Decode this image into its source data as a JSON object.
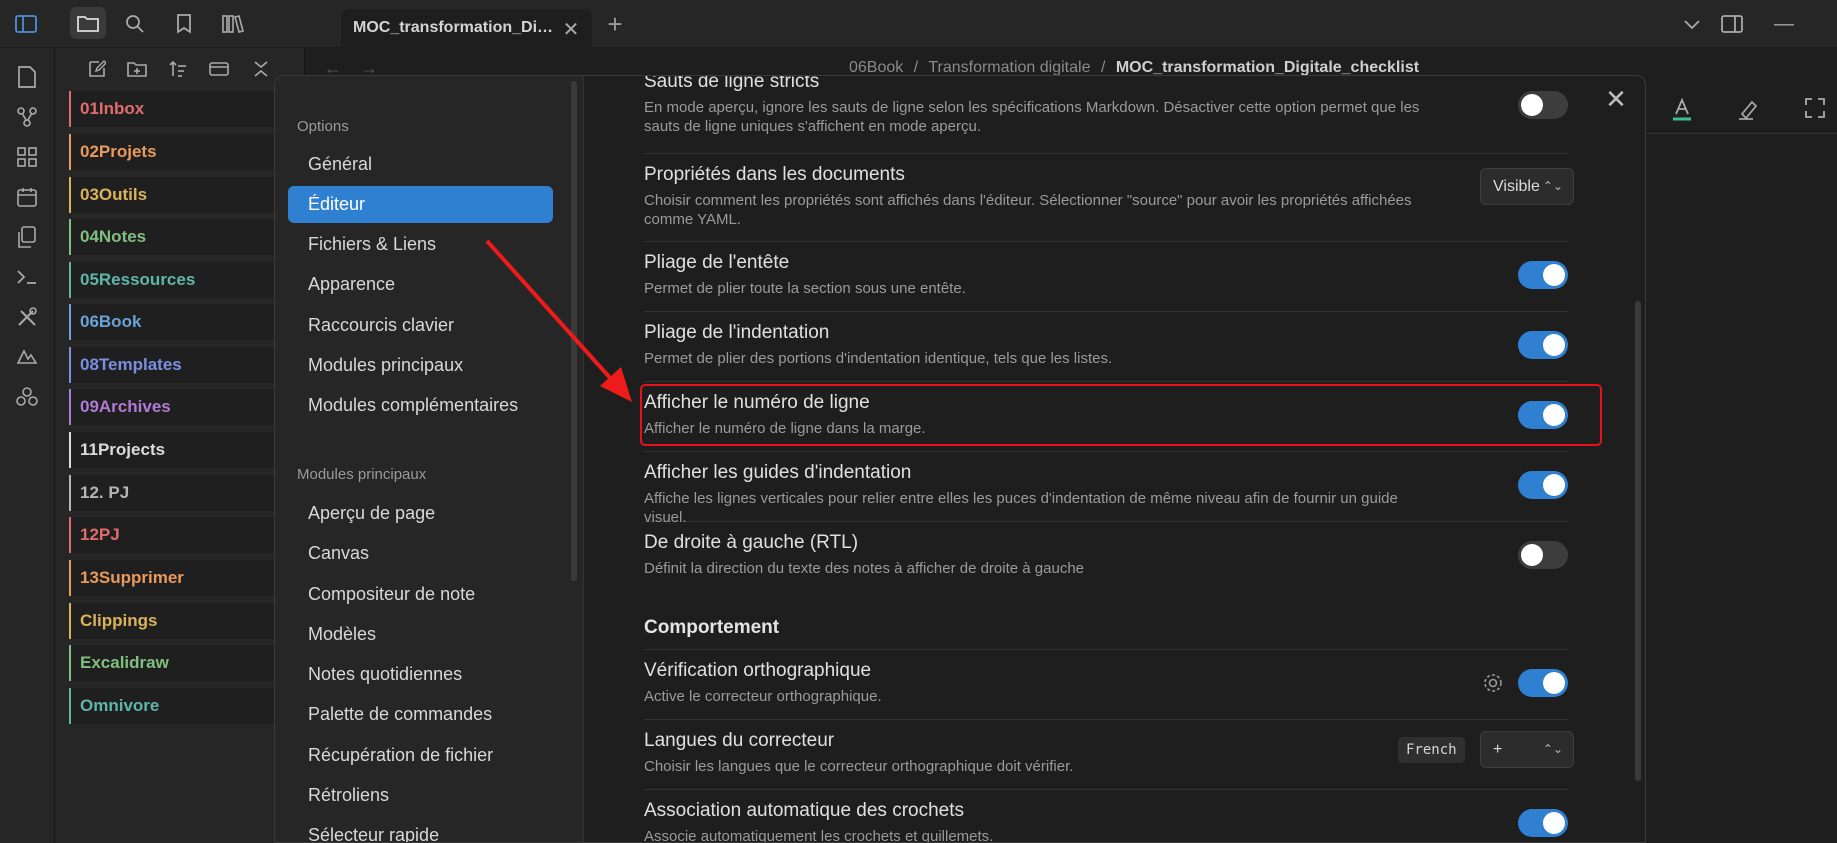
{
  "tab": {
    "title": "MOC_transformation_Di…"
  },
  "breadcrumb": {
    "part1": "06Book",
    "sep1": "/",
    "part2": "Transformation digitale",
    "sep2": "/",
    "current": "MOC_transformation_Digitale_checklist"
  },
  "folders": [
    {
      "label": "01Inbox",
      "color": "#e06c6c"
    },
    {
      "label": "02Projets",
      "color": "#e89a5c"
    },
    {
      "label": "03Outils",
      "color": "#d9b35a"
    },
    {
      "label": "04Notes",
      "color": "#7fbf7f"
    },
    {
      "label": "05Ressources",
      "color": "#5fb6a8"
    },
    {
      "label": "06Book",
      "color": "#6ba3d6"
    },
    {
      "label": "08Templates",
      "color": "#7a8fe0"
    },
    {
      "label": "09Archives",
      "color": "#b07ad6"
    },
    {
      "label": "11Projects",
      "color": "#dcdcdc"
    },
    {
      "label": "12. PJ",
      "color": "#b5b5b5"
    },
    {
      "label": "12PJ",
      "color": "#e06c6c"
    },
    {
      "label": "13Supprimer",
      "color": "#e89a5c"
    },
    {
      "label": "Clippings",
      "color": "#d9b35a"
    },
    {
      "label": "Excalidraw",
      "color": "#7fbf7f"
    },
    {
      "label": "Omnivore",
      "color": "#5fb6a8"
    }
  ],
  "sidebar": {
    "options_header": "Options",
    "options_items": [
      "Général",
      "Éditeur",
      "Fichiers & Liens",
      "Apparence",
      "Raccourcis clavier",
      "Modules principaux",
      "Modules complémentaires"
    ],
    "active_item": "Éditeur",
    "modules_header": "Modules principaux",
    "modules_items": [
      "Aperçu de page",
      "Canvas",
      "Compositeur de note",
      "Modèles",
      "Notes quotidiennes",
      "Palette de commandes",
      "Récupération de fichier",
      "Rétroliens",
      "Sélecteur rapide"
    ]
  },
  "settings": [
    {
      "name": "Sauts de ligne stricts",
      "desc": "En mode aperçu, ignore les sauts de ligne selon les spécifications Markdown. Désactiver cette option permet que les sauts de ligne uniques s'affichent en mode aperçu.",
      "toggle": false
    },
    {
      "name": "Propriétés dans les documents",
      "desc": "Choisir comment les propriétés sont affichés dans l'éditeur. Sélectionner \"source\" pour avoir les propriétés affichées comme YAML.",
      "dropdown": "Visible"
    },
    {
      "name": "Pliage de l'entête",
      "desc": "Permet de plier toute la section sous une entête.",
      "toggle": true
    },
    {
      "name": "Pliage de l'indentation",
      "desc": "Permet de plier des portions d'indentation identique, tels que les listes.",
      "toggle": true
    },
    {
      "name": "Afficher le numéro de ligne",
      "desc": "Afficher le numéro de ligne dans la marge.",
      "toggle": true
    },
    {
      "name": "Afficher les guides d'indentation",
      "desc": "Affiche les lignes verticales pour relier entre elles les puces d'indentation de même niveau afin de fournir un guide visuel.",
      "toggle": true
    },
    {
      "name": "De droite à gauche (RTL)",
      "desc": "Définit la direction du texte des notes à afficher de droite à gauche",
      "toggle": false
    }
  ],
  "behavior": {
    "section_title": "Comportement",
    "items": [
      {
        "name": "Vérification orthographique",
        "desc": "Active le correcteur orthographique.",
        "toggle": true
      },
      {
        "name": "Langues du correcteur",
        "desc": "Choisir les langues que le correcteur orthographique doit vérifier.",
        "lang_chip": "French",
        "dropdown": "+"
      },
      {
        "name": "Association automatique des crochets",
        "desc": "Associe automatiquement les crochets et guillemets.",
        "toggle": true
      }
    ]
  },
  "colors": {
    "accent": "#2f80d1",
    "highlight": "#e8101a",
    "annotation_arrow": "#ee1b1b"
  }
}
